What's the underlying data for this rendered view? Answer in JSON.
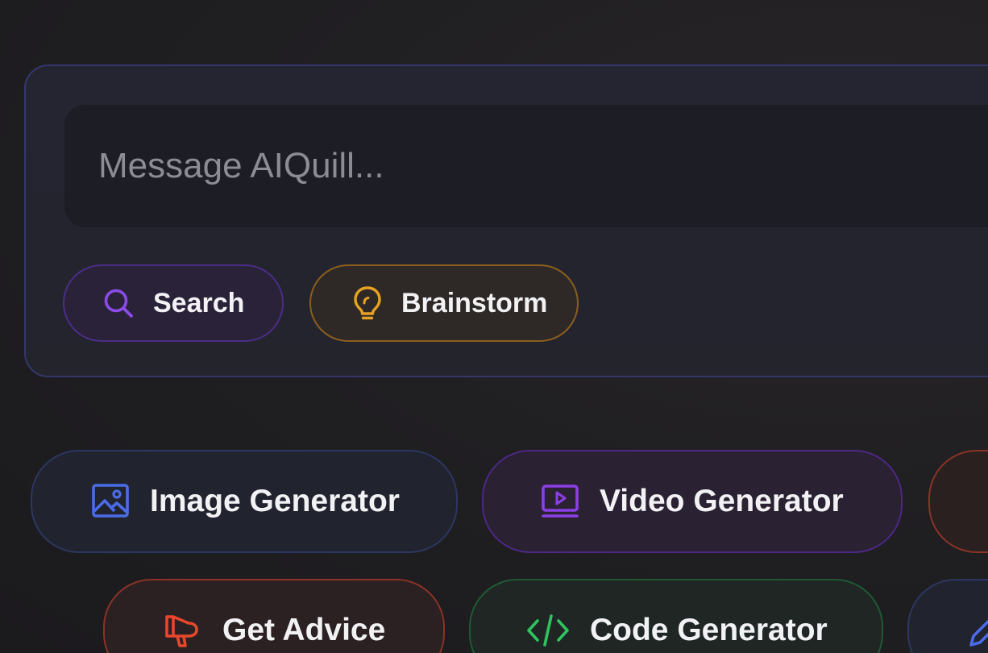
{
  "composer": {
    "placeholder": "Message AIQuill..."
  },
  "actions": [
    {
      "label": "Search",
      "icon": "search-icon",
      "color": "#8b4ce8"
    },
    {
      "label": "Brainstorm",
      "icon": "lightbulb-icon",
      "color": "#e6a125"
    }
  ],
  "tools": {
    "row1": [
      {
        "label": "Image Generator",
        "icon": "image-icon",
        "color": "#4a6ce8"
      },
      {
        "label": "Video Generator",
        "icon": "video-icon",
        "color": "#8b3fe6"
      }
    ],
    "row2": [
      {
        "label": "Get Advice",
        "icon": "megaphone-icon",
        "color": "#e8472d"
      },
      {
        "label": "Code Generator",
        "icon": "code-icon",
        "color": "#2fc45e"
      }
    ]
  },
  "colors": {
    "background": "#1c1b1d",
    "composer_border": "#34376b",
    "placeholder_text": "#8c8c94",
    "label_text": "#f2f2f5"
  }
}
